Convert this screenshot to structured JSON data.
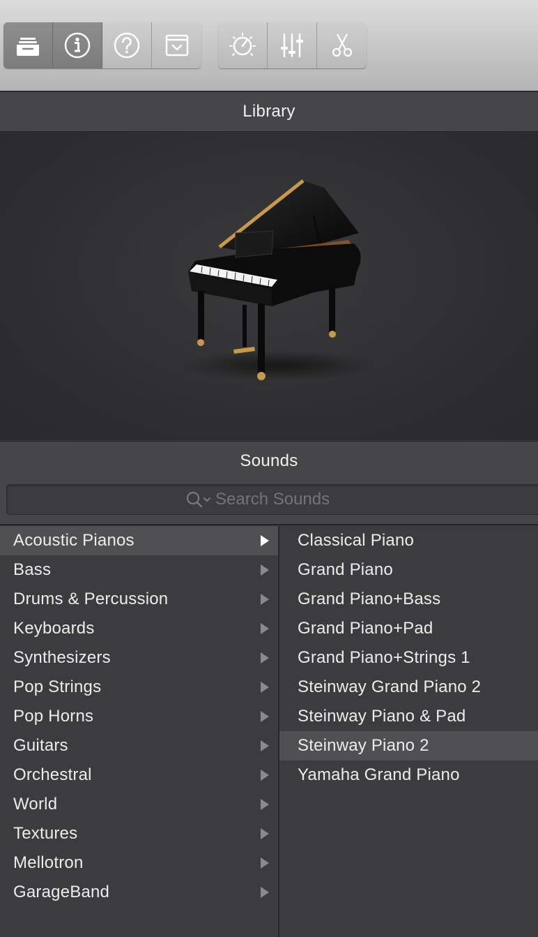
{
  "toolbar": {
    "left_group": [
      {
        "name": "library",
        "icon": "library-tray-icon",
        "active": true
      },
      {
        "name": "info",
        "icon": "info-icon",
        "active": true
      },
      {
        "name": "help",
        "icon": "question-icon",
        "active": false
      },
      {
        "name": "editor",
        "icon": "editor-window-icon",
        "active": false
      }
    ],
    "right_group": [
      {
        "name": "smart-controls",
        "icon": "dial-icon"
      },
      {
        "name": "mixer",
        "icon": "sliders-icon"
      },
      {
        "name": "editors",
        "icon": "scissors-icon"
      }
    ]
  },
  "library": {
    "title": "Library"
  },
  "sounds": {
    "title": "Sounds",
    "search_placeholder": "Search Sounds",
    "categories": [
      {
        "label": "Acoustic Pianos",
        "selected": true
      },
      {
        "label": "Bass",
        "selected": false
      },
      {
        "label": "Drums & Percussion",
        "selected": false
      },
      {
        "label": "Keyboards",
        "selected": false
      },
      {
        "label": "Synthesizers",
        "selected": false
      },
      {
        "label": "Pop Strings",
        "selected": false
      },
      {
        "label": "Pop Horns",
        "selected": false
      },
      {
        "label": "Guitars",
        "selected": false
      },
      {
        "label": "Orchestral",
        "selected": false
      },
      {
        "label": "World",
        "selected": false
      },
      {
        "label": "Textures",
        "selected": false
      },
      {
        "label": "Mellotron",
        "selected": false
      },
      {
        "label": "GarageBand",
        "selected": false
      }
    ],
    "patches": [
      {
        "label": "Classical Piano",
        "selected": false
      },
      {
        "label": "Grand Piano",
        "selected": false
      },
      {
        "label": "Grand Piano+Bass",
        "selected": false
      },
      {
        "label": "Grand Piano+Pad",
        "selected": false
      },
      {
        "label": "Grand Piano+Strings 1",
        "selected": false
      },
      {
        "label": "Steinway Grand Piano 2",
        "selected": false
      },
      {
        "label": "Steinway Piano & Pad",
        "selected": false
      },
      {
        "label": "Steinway Piano 2",
        "selected": true
      },
      {
        "label": "Yamaha Grand Piano",
        "selected": false
      }
    ]
  },
  "colors": {
    "panel": "#3c3c3e",
    "header": "#464648",
    "selected_row": "#505052",
    "text": "#ececec",
    "toolbar_active": "#858585"
  }
}
